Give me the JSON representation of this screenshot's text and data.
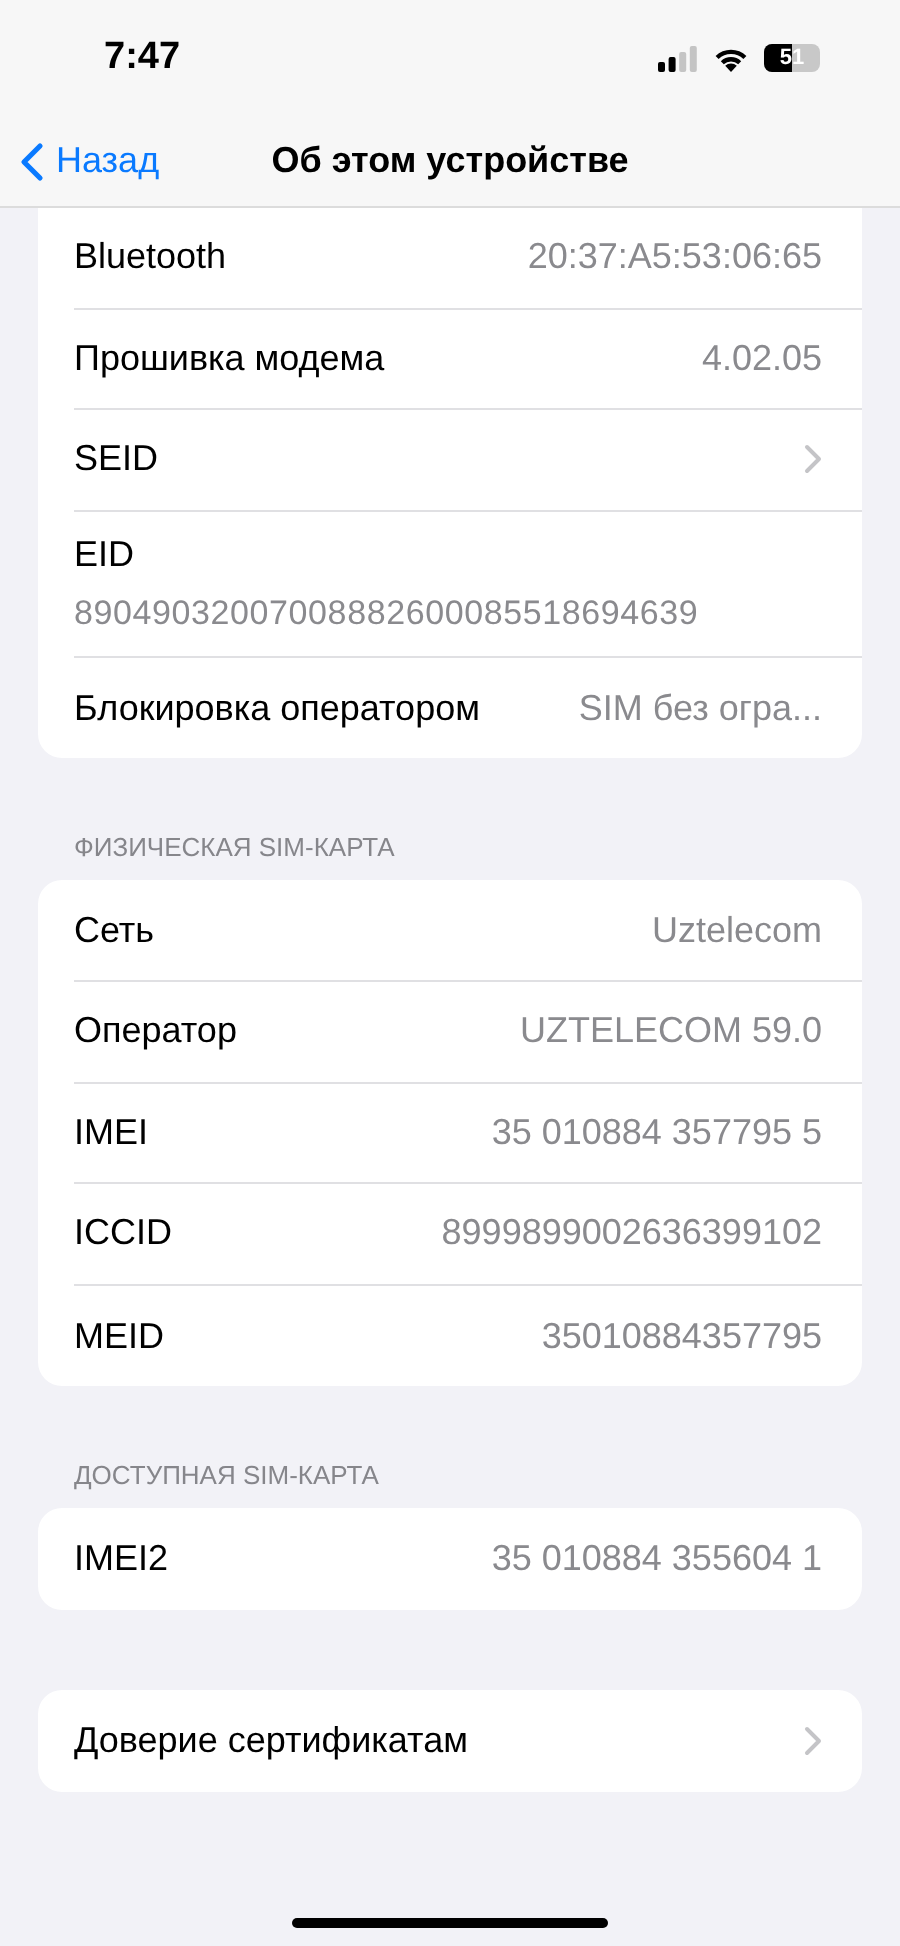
{
  "status_bar": {
    "time": "7:47",
    "battery_percent": "51"
  },
  "nav": {
    "back": "Назад",
    "title": "Об этом устройстве"
  },
  "groups": [
    {
      "rows": [
        {
          "kind": "value",
          "label": "Bluetooth",
          "value": "20:37:A5:53:06:65"
        },
        {
          "kind": "value",
          "label": "Прошивка модема",
          "value": "4.02.05"
        },
        {
          "kind": "chevron",
          "label": "SEID"
        },
        {
          "kind": "stacked",
          "label": "EID",
          "value": "89049032007008882600085518694639"
        },
        {
          "kind": "value",
          "label": "Блокировка оператором",
          "value": "SIM без огра..."
        }
      ]
    },
    {
      "header": "ФИЗИЧЕСКАЯ SIM-КАРТА",
      "rows": [
        {
          "kind": "value",
          "label": "Сеть",
          "value": "Uztelecom"
        },
        {
          "kind": "value",
          "label": "Оператор",
          "value": "UZTELECOM 59.0"
        },
        {
          "kind": "value",
          "label": "IMEI",
          "value": "35 010884 357795 5"
        },
        {
          "kind": "value",
          "label": "ICCID",
          "value": "8999899002636399102"
        },
        {
          "kind": "value",
          "label": "MEID",
          "value": "35010884357795"
        }
      ]
    },
    {
      "header": "ДОСТУПНАЯ SIM-КАРТА",
      "rows": [
        {
          "kind": "value",
          "label": "IMEI2",
          "value": "35 010884 355604 1"
        }
      ]
    },
    {
      "rows": [
        {
          "kind": "chevron",
          "label": "Доверие сертификатам"
        }
      ]
    }
  ]
}
